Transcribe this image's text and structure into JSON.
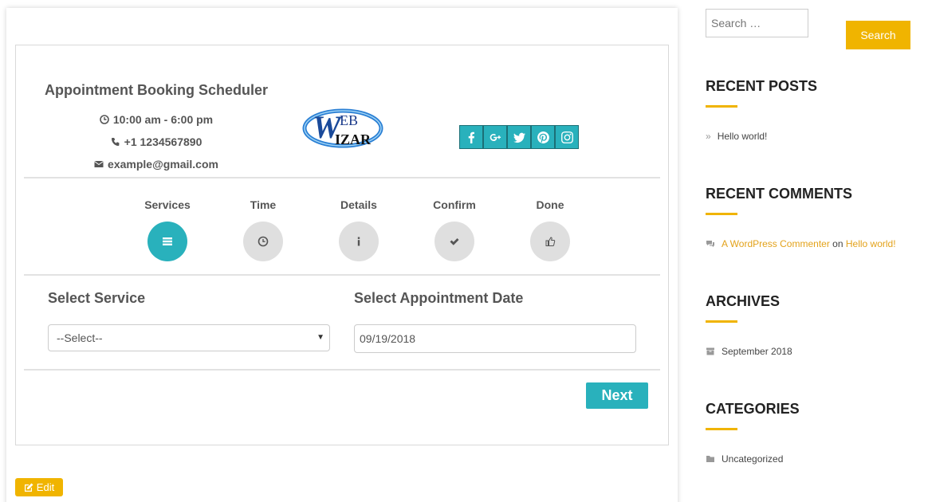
{
  "business": {
    "title": "Appointment Booking Scheduler",
    "hours": "10:00 am - 6:00 pm",
    "phone": "+1 1234567890",
    "email": "example@gmail.com"
  },
  "logo": {
    "text_top": "EB",
    "text_bottom": "IZAR"
  },
  "social": [
    "facebook-icon",
    "google-plus-icon",
    "twitter-icon",
    "pinterest-icon",
    "instagram-icon"
  ],
  "steps": [
    {
      "label": "Services",
      "icon": "list-icon",
      "active": true
    },
    {
      "label": "Time",
      "icon": "clock-icon",
      "active": false
    },
    {
      "label": "Details",
      "icon": "info-icon",
      "active": false
    },
    {
      "label": "Confirm",
      "icon": "check-icon",
      "active": false
    },
    {
      "label": "Done",
      "icon": "thumbs-up-icon",
      "active": false
    }
  ],
  "form": {
    "service_label": "Select Service",
    "service_value": "--Select--",
    "date_label": "Select Appointment Date",
    "date_value": "09/19/2018",
    "next_label": "Next"
  },
  "edit_label": "Edit",
  "sidebar": {
    "search_placeholder": "Search …",
    "search_button": "Search",
    "recent_posts_title": "RECENT POSTS",
    "recent_posts": [
      "Hello world!"
    ],
    "recent_comments_title": "RECENT COMMENTS",
    "comment": {
      "author": "A WordPress Commenter",
      "on": "on",
      "post": "Hello world!"
    },
    "archives_title": "ARCHIVES",
    "archives": [
      "September 2018"
    ],
    "categories_title": "CATEGORIES",
    "categories": [
      "Uncategorized"
    ]
  },
  "colors": {
    "accent": "#29b1bc",
    "brand_yellow": "#f0b400",
    "link": "#e3a21a"
  }
}
